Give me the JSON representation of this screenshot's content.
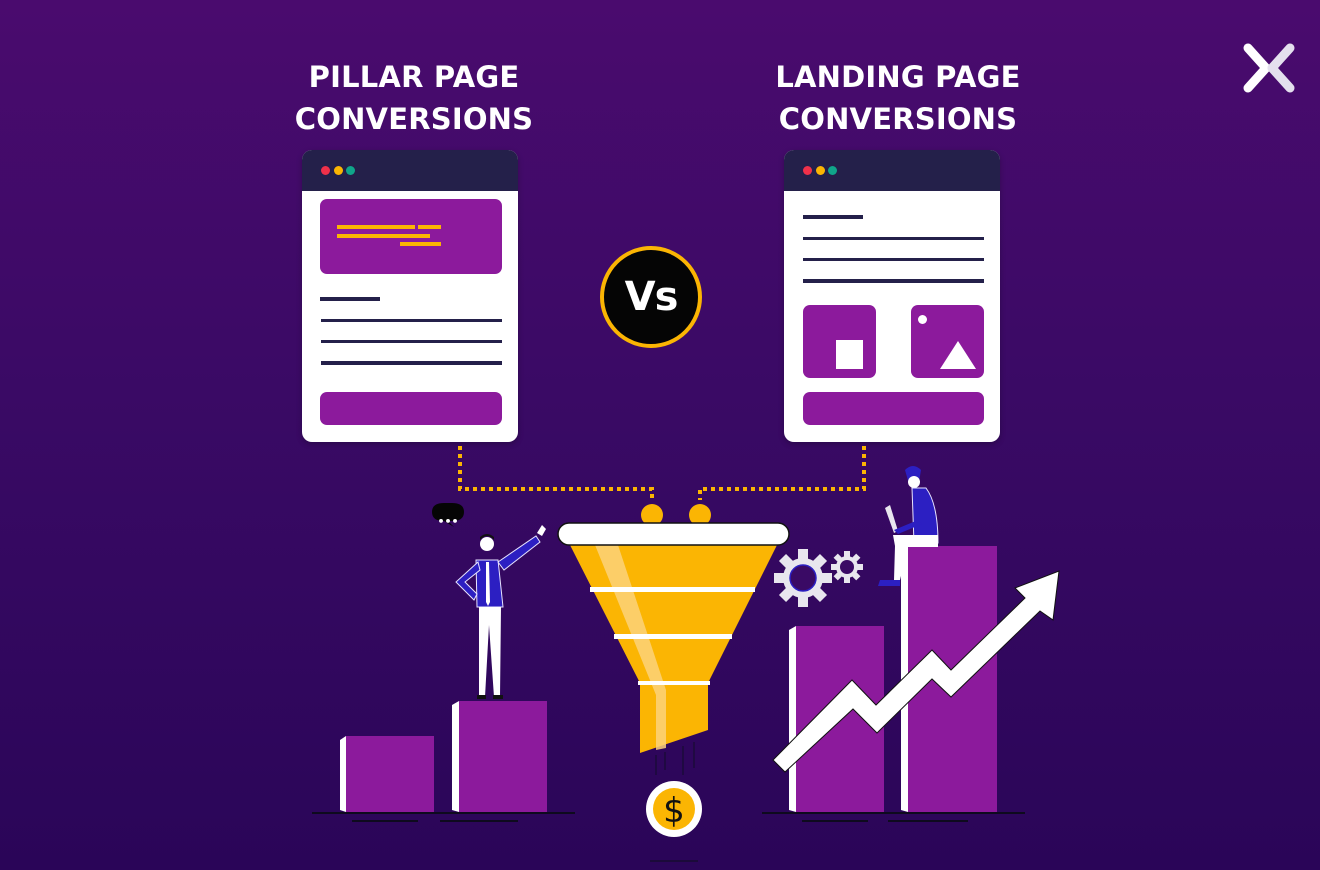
{
  "headings": {
    "left": "PILLAR PAGE CONVERSIONS",
    "left_line1": "PILLAR PAGE",
    "left_line2": "CONVERSIONS",
    "right_line1": "LANDING PAGE",
    "right_line2": "CONVERSIONS"
  },
  "vs_badge": "Vs",
  "coin_symbol": "$",
  "speech_bubble": "•••",
  "logo_icon": "x-brand-logo-icon",
  "colors": {
    "background_top": "#4a0b6e",
    "background_bottom": "#2a0558",
    "accent_yellow": "#fbb503",
    "accent_purple": "#8c1a9c",
    "dark_navy": "#24204a",
    "white": "#ffffff"
  },
  "illustration": {
    "left_browser": "pillar-page-mockup",
    "right_browser": "landing-page-mockup",
    "center": "conversion-funnel",
    "left_chart": "two-bar-chart-low",
    "right_chart": "two-bar-chart-high-with-up-arrow"
  }
}
